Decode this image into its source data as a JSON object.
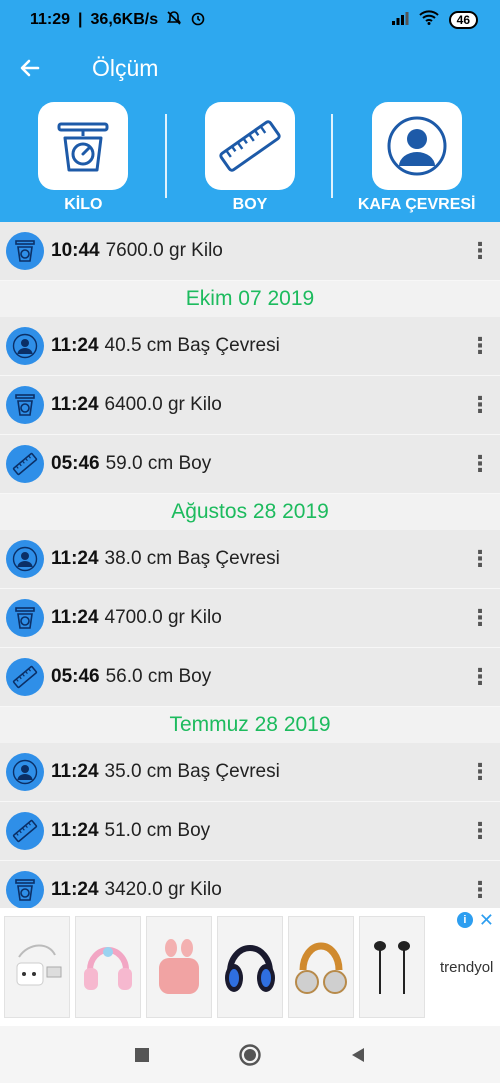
{
  "status": {
    "time": "11:29",
    "net_speed": "36,6KB/s",
    "battery": "46"
  },
  "app": {
    "title": "Ölçüm"
  },
  "categories": [
    {
      "label": "KİLO",
      "icon": "scale-icon"
    },
    {
      "label": "BOY",
      "icon": "ruler-icon"
    },
    {
      "label": "KAFA ÇEVRESİ",
      "icon": "person-icon"
    }
  ],
  "entries_top": [
    {
      "time": "10:44",
      "value": "7600.0 gr Kilo",
      "icon": "scale-icon"
    }
  ],
  "groups": [
    {
      "date": "Ekim 07 2019",
      "entries": [
        {
          "time": "11:24",
          "value": "40.5 cm Baş Çevresi",
          "icon": "person-icon"
        },
        {
          "time": "11:24",
          "value": "6400.0 gr Kilo",
          "icon": "scale-icon"
        },
        {
          "time": "05:46",
          "value": "59.0 cm Boy",
          "icon": "ruler-icon"
        }
      ]
    },
    {
      "date": "Ağustos 28 2019",
      "entries": [
        {
          "time": "11:24",
          "value": "38.0 cm Baş Çevresi",
          "icon": "person-icon"
        },
        {
          "time": "11:24",
          "value": "4700.0 gr Kilo",
          "icon": "scale-icon"
        },
        {
          "time": "05:46",
          "value": "56.0 cm Boy",
          "icon": "ruler-icon"
        }
      ]
    },
    {
      "date": "Temmuz 28 2019",
      "entries": [
        {
          "time": "11:24",
          "value": "35.0 cm Baş Çevresi",
          "icon": "person-icon"
        },
        {
          "time": "11:24",
          "value": "51.0 cm Boy",
          "icon": "ruler-icon"
        },
        {
          "time": "11:24",
          "value": "3420.0 gr Kilo",
          "icon": "scale-icon"
        }
      ]
    }
  ],
  "ad": {
    "brand": "trendyol",
    "products": [
      "usb-adapter",
      "pink-kids-headphones",
      "pink-earbuds-case",
      "blue-gaming-headset",
      "gold-headphones",
      "black-earphones"
    ]
  },
  "colors": {
    "primary": "#2ea8ef",
    "date_green": "#1dbb5e",
    "icon_blue": "#2f8fe8"
  }
}
